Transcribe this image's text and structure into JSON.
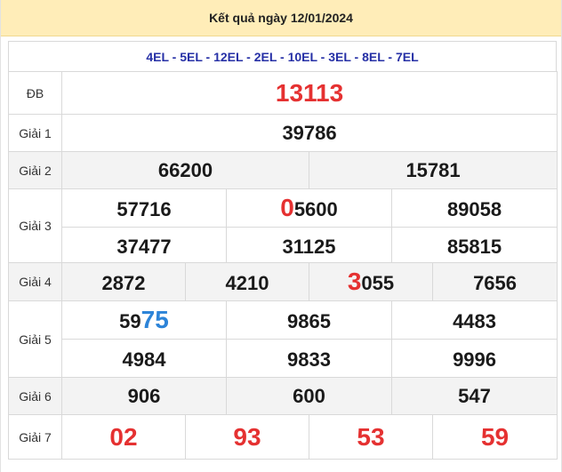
{
  "header": {
    "title": "Kết quả ngày 12/01/2024"
  },
  "codes": "4EL - 5EL - 12EL - 2EL - 10EL - 3EL - 8EL - 7EL",
  "labels": {
    "db": "ĐB",
    "g1": "Giải 1",
    "g2": "Giải 2",
    "g3": "Giải 3",
    "g4": "Giải 4",
    "g5": "Giải 5",
    "g6": "Giải 6",
    "g7": "Giải 7"
  },
  "prizes": {
    "db": "13113",
    "g1": "39786",
    "g2": [
      "66200",
      "15781"
    ],
    "g3": [
      {
        "hl": "",
        "rest": "57716"
      },
      {
        "hl": "0",
        "rest": "5600"
      },
      {
        "hl": "",
        "rest": "89058"
      },
      {
        "hl": "",
        "rest": "37477"
      },
      {
        "hl": "",
        "rest": "31125"
      },
      {
        "hl": "",
        "rest": "85815"
      }
    ],
    "g4": [
      {
        "hl": "",
        "rest": "2872"
      },
      {
        "hl": "",
        "rest": "4210"
      },
      {
        "hl": "3",
        "rest": "055"
      },
      {
        "hl": "",
        "rest": "7656"
      }
    ],
    "g5": [
      {
        "pre": "59",
        "hl": "75"
      },
      {
        "pre": "9865",
        "hl": ""
      },
      {
        "pre": "4483",
        "hl": ""
      },
      {
        "pre": "4984",
        "hl": ""
      },
      {
        "pre": "9833",
        "hl": ""
      },
      {
        "pre": "9996",
        "hl": ""
      }
    ],
    "g6": [
      "906",
      "600",
      "547"
    ],
    "g7": [
      "02",
      "93",
      "53",
      "59"
    ]
  },
  "colors": {
    "red": "#e53131",
    "blue": "#2d84d8",
    "header_bg": "#ffedb8",
    "code_text": "#2630a6"
  }
}
